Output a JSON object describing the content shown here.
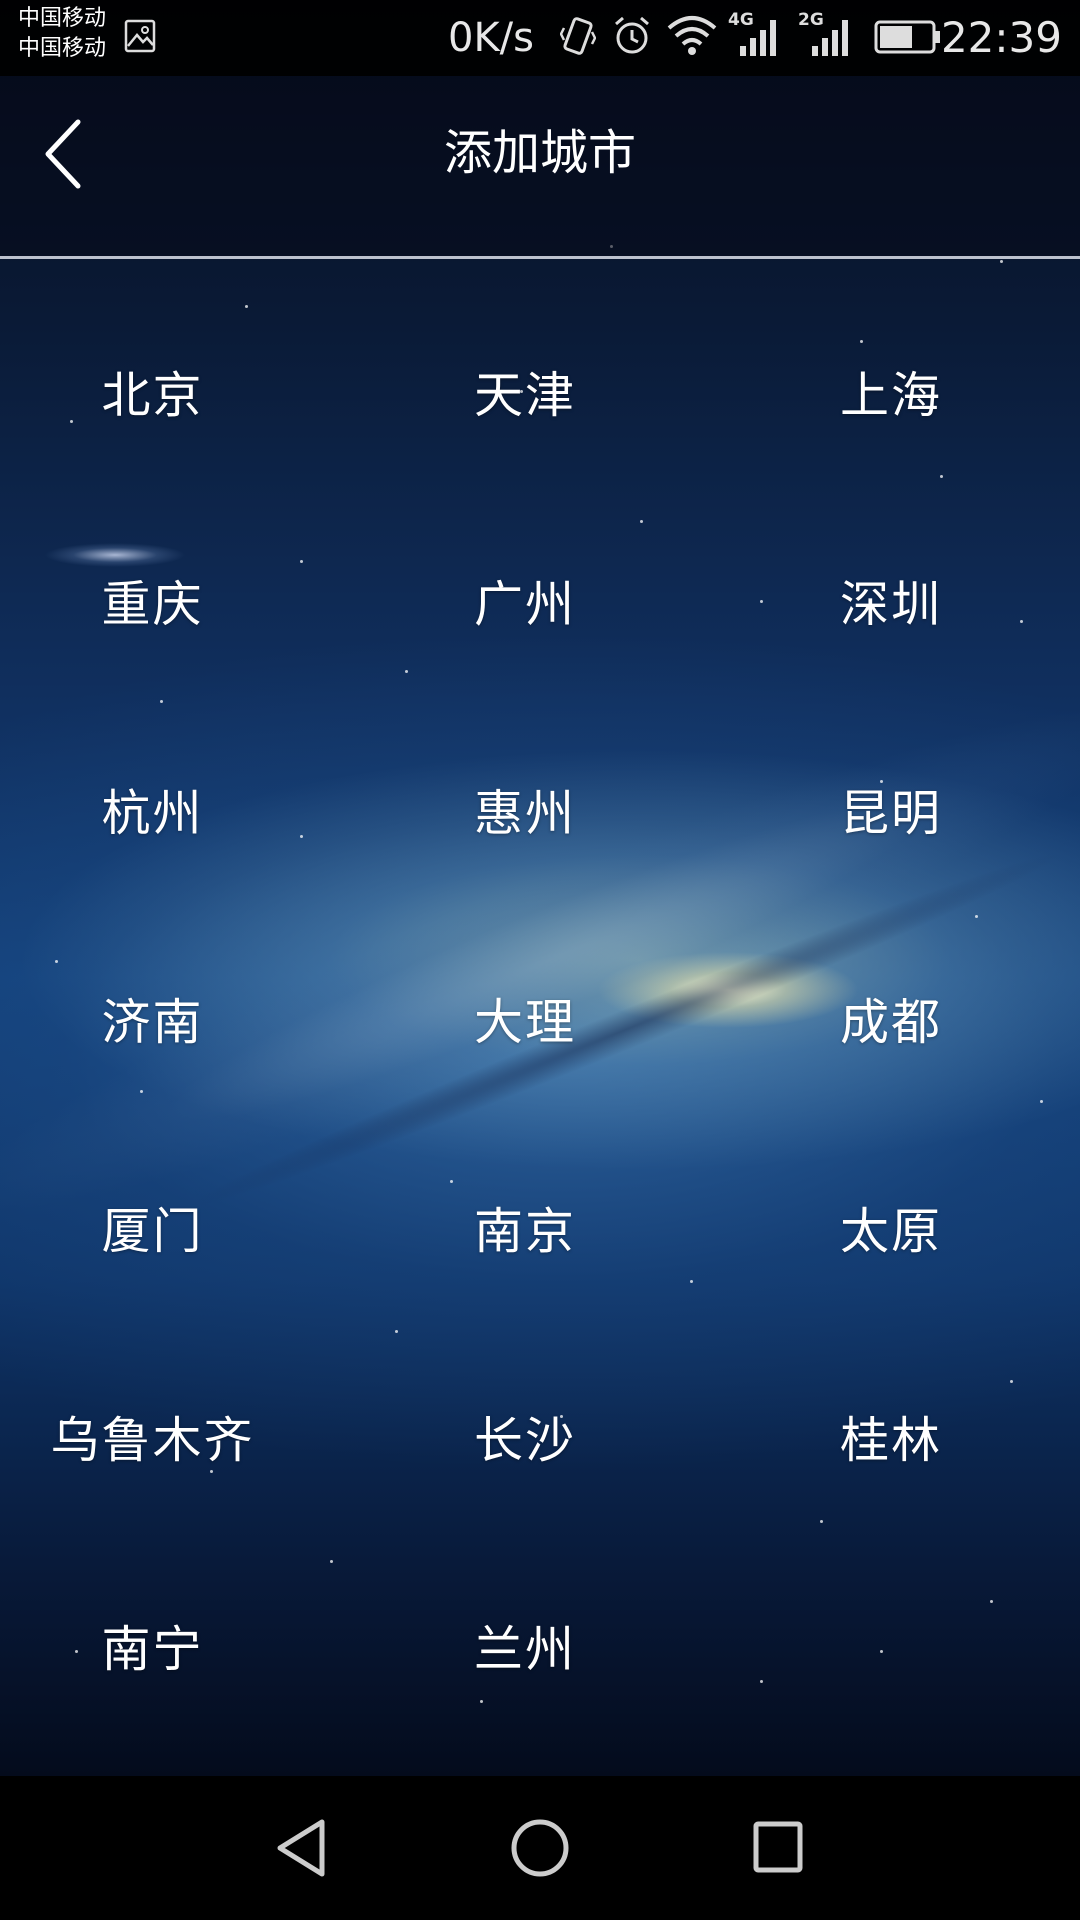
{
  "status_bar": {
    "carrier_line1": "中国移动",
    "carrier_line2": "中国移动",
    "network_speed": "0K/s",
    "signal1_type": "4G",
    "signal2_type": "2G",
    "time": "22:39"
  },
  "header": {
    "title": "添加城市",
    "back_icon": "chevron-left-icon"
  },
  "cities": [
    "北京",
    "天津",
    "上海",
    "重庆",
    "广州",
    "深圳",
    "杭州",
    "惠州",
    "昆明",
    "济南",
    "大理",
    "成都",
    "厦门",
    "南京",
    "太原",
    "乌鲁木齐",
    "长沙",
    "桂林",
    "南宁",
    "兰州"
  ],
  "nav_bar": {
    "back_icon": "triangle-back-icon",
    "home_icon": "circle-home-icon",
    "recents_icon": "square-recents-icon"
  },
  "colors": {
    "text": "#ffffff",
    "status_bar_bg": "#000000",
    "divider": "#dce1eb"
  }
}
